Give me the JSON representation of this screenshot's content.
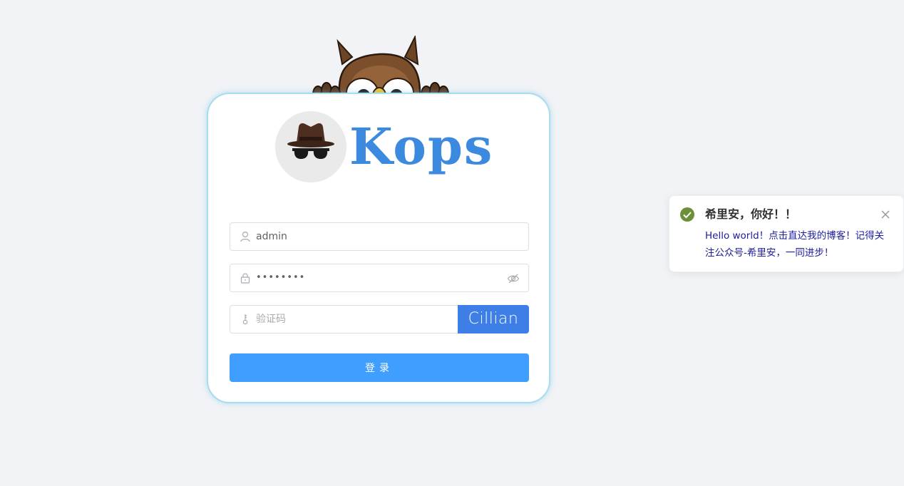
{
  "brand": {
    "name": "Kops",
    "accent": "#3b8ae0"
  },
  "form": {
    "username": {
      "value": "admin",
      "icon": "user-icon"
    },
    "password": {
      "value": "••••••••",
      "icon": "lock-icon",
      "toggle_icon": "eye-off-icon"
    },
    "captcha_input": {
      "placeholder": "验证码",
      "icon": "key-icon"
    },
    "captcha_text": "Cillian",
    "login_label": "登录"
  },
  "notification": {
    "type": "success",
    "title": "希里安，你好！！",
    "message": "Hello world！点击直达我的博客！记得关注公众号-希里安，一同进步！",
    "success_color": "#6c8f3a"
  },
  "colors": {
    "primary": "#409eff",
    "captcha_bg": "#3d7fe6",
    "background": "#f1f3f6"
  }
}
